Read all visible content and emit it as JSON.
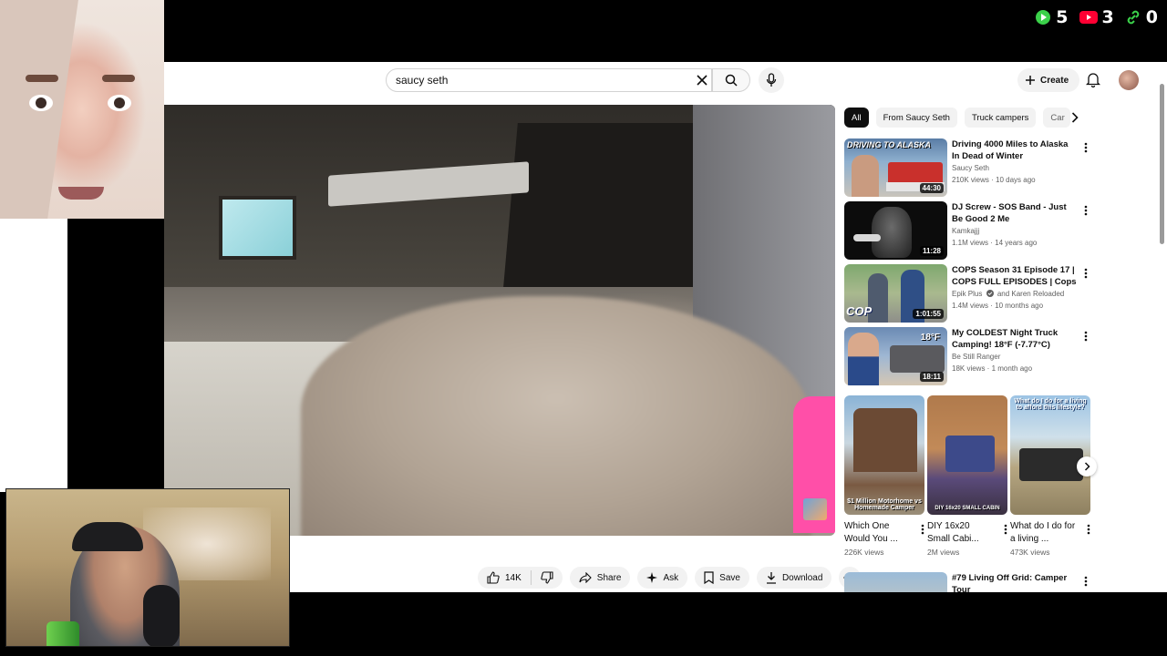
{
  "counters": [
    {
      "icon": "play-icon",
      "value": "5",
      "color": "#3bd14a"
    },
    {
      "icon": "youtube-icon",
      "value": "3",
      "color": "#ff0033"
    },
    {
      "icon": "link-icon",
      "value": "0",
      "color": "#3bd14a"
    }
  ],
  "header": {
    "search_value": "saucy seth",
    "create_label": "Create"
  },
  "actions": {
    "likes": "14K",
    "share": "Share",
    "ask": "Ask",
    "save": "Save",
    "download": "Download"
  },
  "chips": [
    "All",
    "From Saucy Seth",
    "Truck campers",
    "Car"
  ],
  "recommendations": [
    {
      "title": "Driving 4000 Miles to Alaska In Dead of Winter",
      "channel": "Saucy Seth",
      "meta": "210K views · 10 days ago",
      "duration": "44:30",
      "thumb_text": "DRIVING TO ALASKA"
    },
    {
      "title": "DJ Screw - SOS Band - Just Be Good 2 Me",
      "channel": "Kamkajjj",
      "meta": "1.1M views · 14 years ago",
      "duration": "11:28"
    },
    {
      "title": "COPS Season 31 Episode 17 | COPS FULL EPISODES | Cops ...",
      "channel": "Epik Plus",
      "channel_extra": "and Karen Reloaded",
      "meta": "1.4M views · 10 months ago",
      "duration": "1:01:55",
      "thumb_text": "COP"
    },
    {
      "title": "My COLDEST Night Truck Camping! 18°F (-7.77°C)",
      "channel": "Be Still Ranger",
      "meta": "18K views · 1 month ago",
      "duration": "18:11",
      "thumb_text": "18°F"
    }
  ],
  "shorts": [
    {
      "title": "Which One Would You ...",
      "views": "226K views",
      "thumb_text": "$1 Million Motorhome vs Homemade Camper"
    },
    {
      "title": "DIY 16x20 Small Cabi...",
      "views": "2M views",
      "thumb_text": "DIY 16x20 SMALL CABIN"
    },
    {
      "title": "What do I do for a living ...",
      "views": "473K views",
      "thumb_text": "What do I do for a living to afford this lifestyle?"
    }
  ],
  "next_rec": {
    "title": "#79 Living Off Grid: Camper Tour"
  }
}
